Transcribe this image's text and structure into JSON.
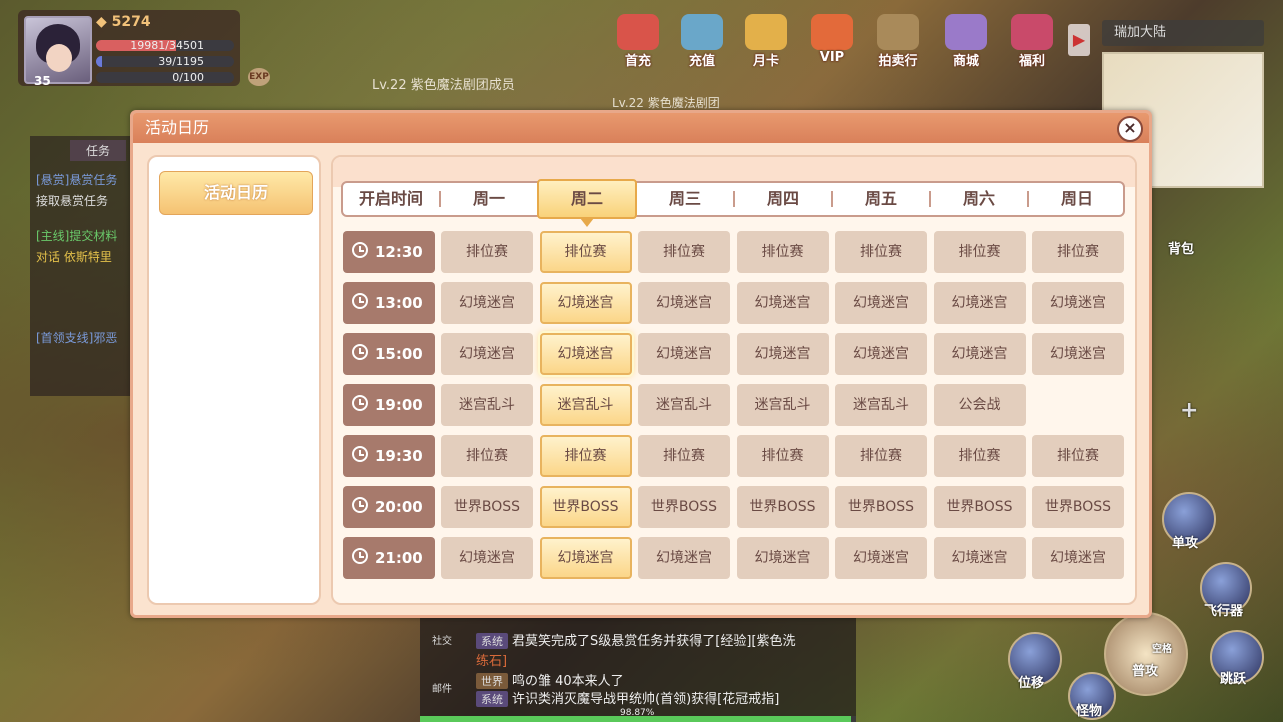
{
  "player": {
    "level": "35",
    "gems": "5274",
    "hp": "19981/34501",
    "mp": "39/1195",
    "sp": "0/100",
    "exp_label": "EXP"
  },
  "world": {
    "name_tag_1": "Lv.22 紫色魔法剧团成员",
    "name_tag_2": "Lv.22 紫色魔法剧团",
    "region": "瑞加大陆"
  },
  "top_menu": [
    "首充",
    "充值",
    "月卡",
    "VIP",
    "拍卖行",
    "商城",
    "福利"
  ],
  "quest_panel": {
    "tab": "任务",
    "items": [
      "[悬赏]悬赏任务",
      "接取悬赏任务",
      "[主线]提交材料",
      "对话 依斯特里",
      "[首领支线]邪恶"
    ]
  },
  "dialog": {
    "title": "活动日历",
    "side_button": "活动日历",
    "close": "×",
    "header": [
      "开启时间",
      "周一",
      "周二",
      "周三",
      "周四",
      "周五",
      "周六",
      "周日"
    ],
    "selected_day_index": 1,
    "rows": [
      {
        "time": "12:30",
        "cells": [
          "排位赛",
          "排位赛",
          "排位赛",
          "排位赛",
          "排位赛",
          "排位赛",
          "排位赛"
        ]
      },
      {
        "time": "13:00",
        "cells": [
          "幻境迷宫",
          "幻境迷宫",
          "幻境迷宫",
          "幻境迷宫",
          "幻境迷宫",
          "幻境迷宫",
          "幻境迷宫"
        ]
      },
      {
        "time": "15:00",
        "cells": [
          "幻境迷宫",
          "幻境迷宫",
          "幻境迷宫",
          "幻境迷宫",
          "幻境迷宫",
          "幻境迷宫",
          "幻境迷宫"
        ]
      },
      {
        "time": "19:00",
        "cells": [
          "迷宫乱斗",
          "迷宫乱斗",
          "迷宫乱斗",
          "迷宫乱斗",
          "迷宫乱斗",
          "公会战",
          ""
        ]
      },
      {
        "time": "19:30",
        "cells": [
          "排位赛",
          "排位赛",
          "排位赛",
          "排位赛",
          "排位赛",
          "排位赛",
          "排位赛"
        ]
      },
      {
        "time": "20:00",
        "cells": [
          "世界BOSS",
          "世界BOSS",
          "世界BOSS",
          "世界BOSS",
          "世界BOSS",
          "世界BOSS",
          "世界BOSS"
        ]
      },
      {
        "time": "21:00",
        "cells": [
          "幻境迷宫",
          "幻境迷宫",
          "幻境迷宫",
          "幻境迷宫",
          "幻境迷宫",
          "幻境迷宫",
          "幻境迷宫"
        ]
      }
    ]
  },
  "chat": {
    "social": "社交",
    "mail": "邮件",
    "lines": [
      {
        "tag": "系统",
        "text": "君莫笑完成了S级悬赏任务并获得了[经验][紫色洗"
      },
      {
        "tag": "",
        "text": "练石]"
      },
      {
        "tag": "世界",
        "text": "鸣の雏  40本来人了"
      },
      {
        "tag": "系统",
        "text": "许识类消灭魔导战甲统帅(首领)获得[花冠戒指]"
      }
    ],
    "progress": "98.87%"
  },
  "actions": {
    "bag": "背包",
    "single": "单攻",
    "fly": "飞行器",
    "attack": "普攻",
    "jump": "跳跃",
    "shift": "位移",
    "monster": "怪物",
    "space": "空格",
    "plus": "+"
  },
  "colors": {
    "dialog_bg": "#fbe3cf",
    "title_bar": "#d9805a",
    "time_cell": "#a77a6c",
    "cell": "#e3cebd",
    "selected": "#fbd689"
  }
}
